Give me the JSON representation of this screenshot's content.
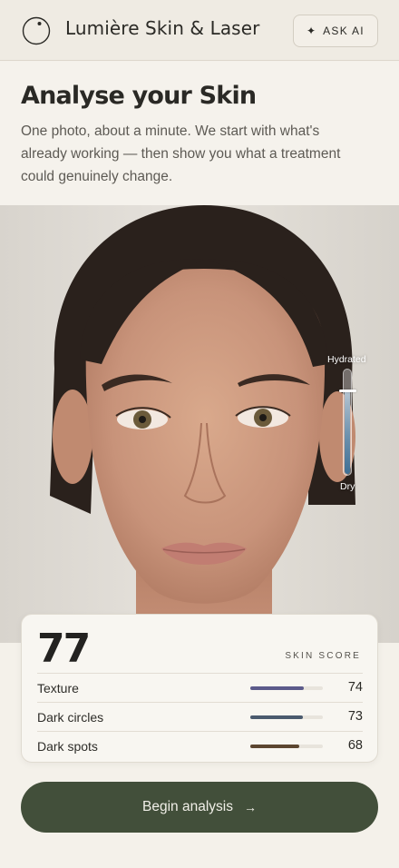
{
  "header": {
    "brand": "Lumière Skin & Laser",
    "ask_ai_label": "ASK AI",
    "ask_ai_icon": "sparkle-icon"
  },
  "intro": {
    "title": "Analyse your Skin",
    "description": "One photo, about a minute. We start with what's already working — then show you what a treatment could genuinely change."
  },
  "hydration": {
    "top_label": "Hydrated",
    "bottom_label": "Dry",
    "level": 0.82
  },
  "score_card": {
    "score": "77",
    "label": "SKIN SCORE",
    "metrics": [
      {
        "name": "Texture",
        "value": "74",
        "fraction": 0.74,
        "color": "#5b5a8a"
      },
      {
        "name": "Dark circles",
        "value": "73",
        "fraction": 0.73,
        "color": "#4a5a6e"
      },
      {
        "name": "Dark spots",
        "value": "68",
        "fraction": 0.68,
        "color": "#5c4630"
      }
    ]
  },
  "cta": {
    "label": "Begin analysis",
    "arrow": "→"
  },
  "colors": {
    "accent": "#424f3a",
    "background": "#f4f1ea"
  }
}
